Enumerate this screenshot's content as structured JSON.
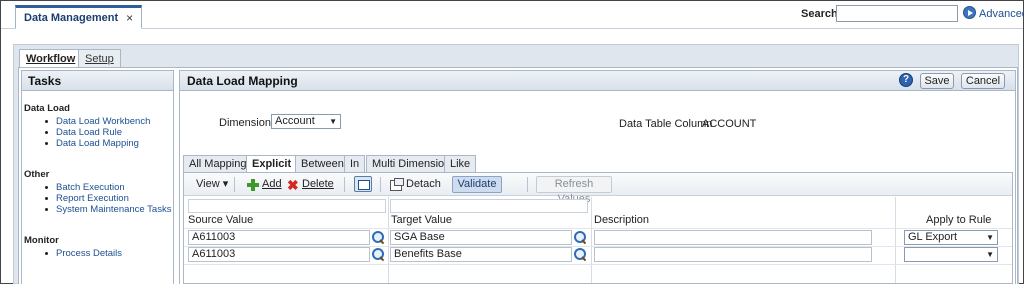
{
  "app": {
    "tab_title": "Data Management",
    "tab_close": "×"
  },
  "search": {
    "label": "Search:",
    "value": "",
    "advanced_label": "Advanced"
  },
  "workflow_tabs": [
    {
      "label": "Workflow"
    },
    {
      "label": "Setup"
    }
  ],
  "tasks": {
    "title": "Tasks",
    "groups": [
      {
        "name": "Data Load",
        "items": [
          "Data Load Workbench",
          "Data Load Rule",
          "Data Load Mapping"
        ]
      },
      {
        "name": "Other",
        "items": [
          "Batch Execution",
          "Report Execution",
          "System Maintenance Tasks"
        ]
      },
      {
        "name": "Monitor",
        "items": [
          "Process Details"
        ]
      }
    ]
  },
  "main": {
    "title": "Data Load Mapping",
    "help_icon": "?",
    "save_label": "Save",
    "cancel_label": "Cancel",
    "dimensions_label": "Dimensions",
    "dimension_value": "Account",
    "data_table_column_label": "Data Table Column",
    "data_table_column_value": "ACCOUNT"
  },
  "mapping_tabs": [
    "All Mappings",
    "Explicit",
    "Between",
    "In",
    "Multi Dimension",
    "Like"
  ],
  "toolbar": {
    "view": "View",
    "add": "Add",
    "delete": "Delete",
    "detach": "Detach",
    "validate": "Validate",
    "refresh": "Refresh Values"
  },
  "grid": {
    "columns": [
      "Source Value",
      "Target Value",
      "Description",
      "Apply to Rule"
    ],
    "rows": [
      {
        "source": "A611003",
        "target": "SGA Base",
        "description": "",
        "rule": "GL Export"
      },
      {
        "source": "A611003",
        "target": "Benefits Base",
        "description": "",
        "rule": ""
      }
    ]
  },
  "colors": {
    "accent": "#1d4f91",
    "header_bg": "#d7e0ea",
    "validate_bg": "#cfdcf0"
  }
}
